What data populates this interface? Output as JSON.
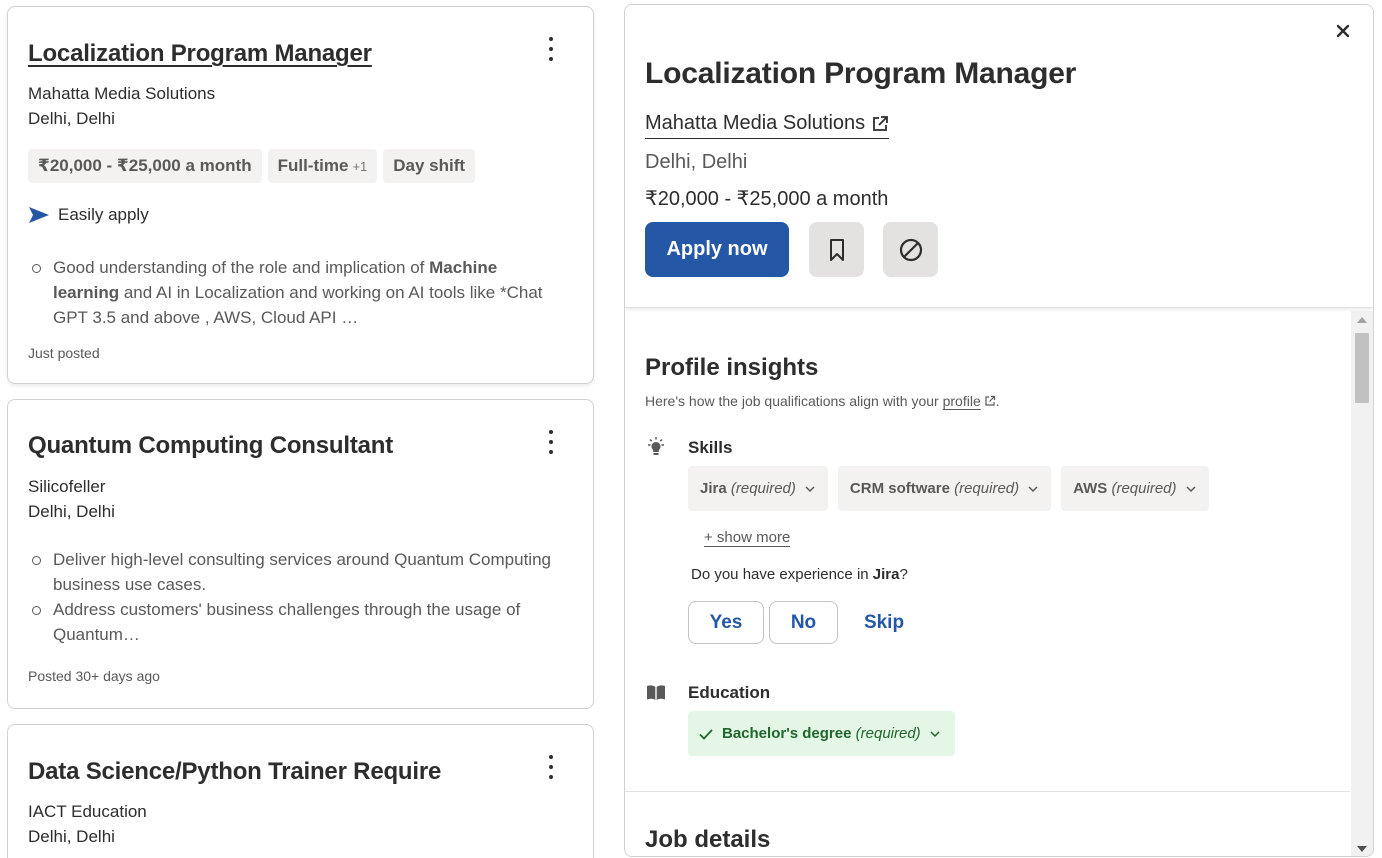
{
  "cards": [
    {
      "title": "Localization Program Manager",
      "company": "Mahatta Media Solutions",
      "location": "Delhi, Delhi",
      "tags": {
        "salary": "₹20,000 - ₹25,000 a month",
        "type": "Full-time",
        "type_more": "+1",
        "shift": "Day shift"
      },
      "easy_apply": "Easily apply",
      "snippet": {
        "before": "Good understanding of the role and implication of ",
        "bold1": "Machine learning",
        "after": " and AI in Localization and working on AI tools like *Chat GPT 3.5 and above , AWS, Cloud API …"
      },
      "posted": "Just posted"
    },
    {
      "title": "Quantum Computing Consultant",
      "company": "Silicofeller",
      "location": "Delhi, Delhi",
      "bullets": [
        "Deliver high-level consulting services around Quantum Computing business use cases.",
        "Address customers' business challenges through the usage of Quantum…"
      ],
      "posted": "Posted 30+ days ago"
    },
    {
      "title": "Data Science/Python Trainer Require",
      "company": "IACT Education",
      "location": "Delhi, Delhi"
    }
  ],
  "detail": {
    "title": "Localization Program Manager",
    "company": "Mahatta Media Solutions",
    "location": "Delhi, Delhi",
    "salary": "₹20,000 - ₹25,000 a month",
    "apply_label": "Apply now",
    "profile_insights": {
      "title": "Profile insights",
      "subtitle_before": "Here's how the job qualifications align with your ",
      "subtitle_link": "profile",
      "subtitle_after": ".",
      "skills_label": "Skills",
      "skills": [
        {
          "name": "Jira",
          "req": "(required)"
        },
        {
          "name": "CRM software",
          "req": "(required)"
        },
        {
          "name": "AWS",
          "req": "(required)"
        }
      ],
      "show_more": "+ show more",
      "question_before": "Do you have experience in ",
      "question_skill": "Jira",
      "question_after": "?",
      "answers": {
        "yes": "Yes",
        "no": "No",
        "skip": "Skip"
      },
      "education_label": "Education",
      "education": {
        "name": "Bachelor's degree",
        "req": "(required)"
      }
    },
    "job_details_title": "Job details"
  },
  "colors": {
    "primary": "#2557a7",
    "text": "#2d2d2d",
    "muted": "#595959",
    "chip_bg": "#f3f2f1",
    "success_bg": "#e4f7e6",
    "success_text": "#1f662c"
  }
}
